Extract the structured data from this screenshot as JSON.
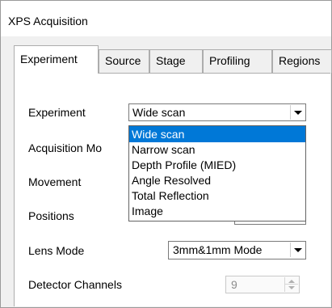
{
  "window": {
    "title": "XPS Acquisition"
  },
  "tabs": [
    {
      "label": "Experiment",
      "active": true
    },
    {
      "label": "Source",
      "active": false
    },
    {
      "label": "Stage",
      "active": false
    },
    {
      "label": "Profiling",
      "active": false
    },
    {
      "label": "Regions",
      "active": false
    }
  ],
  "form": {
    "experiment": {
      "label": "Experiment",
      "value": "Wide scan"
    },
    "acquisition_mode": {
      "label": "Acquisition Mo"
    },
    "movement": {
      "label": "Movement"
    },
    "positions": {
      "label": "Positions"
    },
    "lens_mode": {
      "label": "Lens Mode",
      "value": "3mm&1mm Mode"
    },
    "detector_channels": {
      "label": "Detector Channels",
      "value": "9",
      "enabled": false
    }
  },
  "experiment_dropdown": {
    "open": true,
    "selected": "Wide scan",
    "options": [
      "Wide scan",
      "Narrow scan",
      "Depth Profile (MIED)",
      "Angle Resolved",
      "Total Reflection",
      "Image"
    ]
  },
  "colors": {
    "selection": "#0078d7",
    "tab_background": "#f0f0f0"
  },
  "icons": {
    "combo_arrow": "chevron-down-icon",
    "spinner_up": "spinner-up-icon",
    "spinner_down": "spinner-down-icon"
  }
}
